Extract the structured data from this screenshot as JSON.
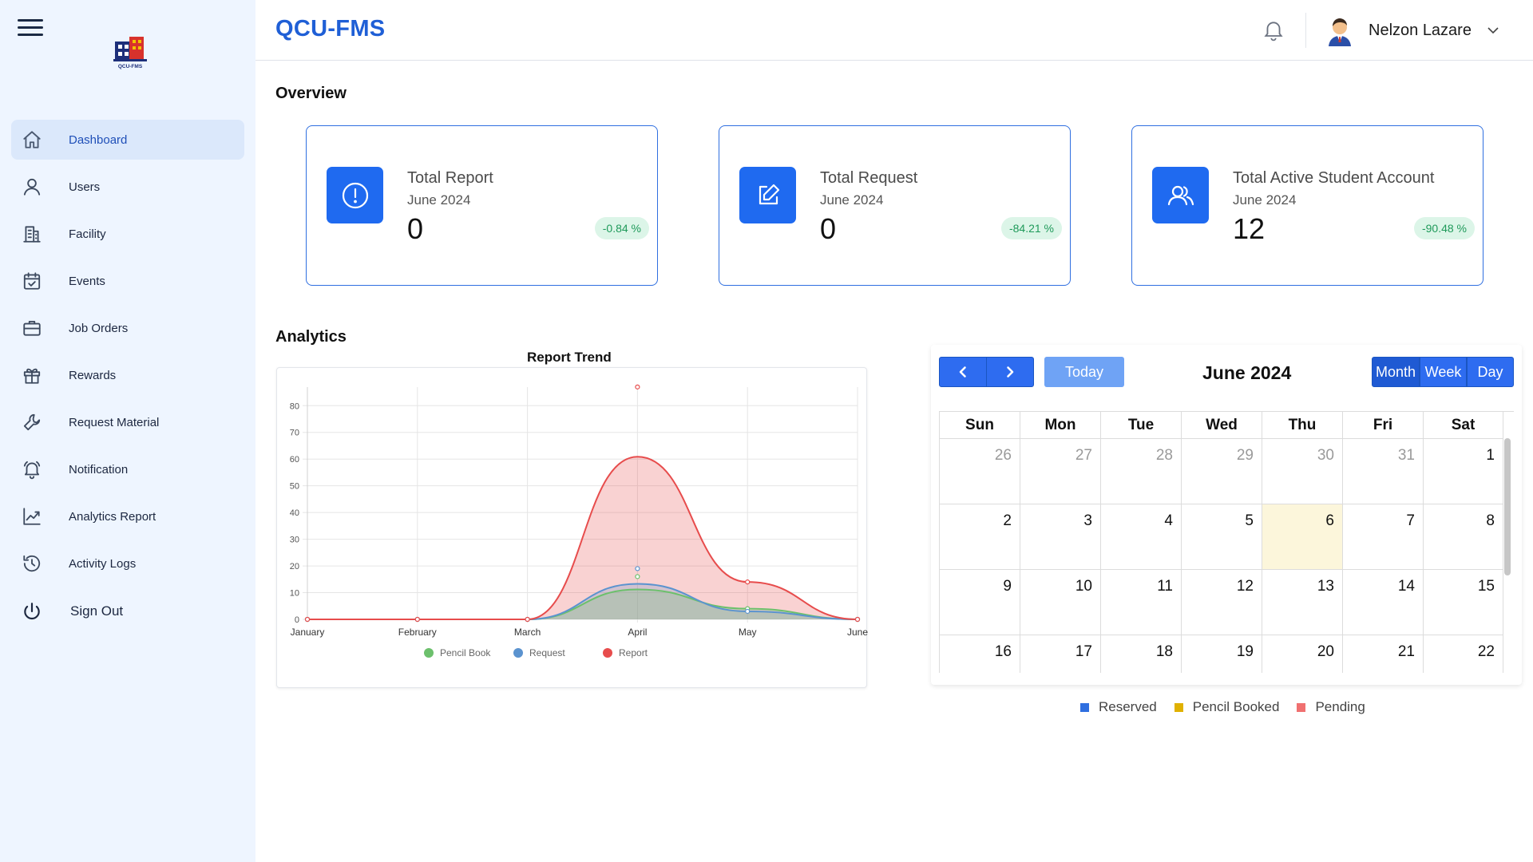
{
  "app": {
    "brand": "QCU-FMS",
    "logo_text": "QCU-FMS"
  },
  "sidebar": {
    "items": [
      {
        "label": "Dashboard",
        "icon": "home-icon",
        "active": true
      },
      {
        "label": "Users",
        "icon": "user-icon"
      },
      {
        "label": "Facility",
        "icon": "building-icon"
      },
      {
        "label": "Events",
        "icon": "calendar-check-icon"
      },
      {
        "label": "Job Orders",
        "icon": "briefcase-icon"
      },
      {
        "label": "Rewards",
        "icon": "gift-icon"
      },
      {
        "label": "Request Material",
        "icon": "wrench-icon"
      },
      {
        "label": "Notification",
        "icon": "bell-icon"
      },
      {
        "label": "Analytics Report",
        "icon": "trend-icon"
      },
      {
        "label": "Activity Logs",
        "icon": "history-icon"
      }
    ],
    "signout": {
      "label": "Sign Out",
      "icon": "power-icon"
    }
  },
  "header": {
    "user_name": "Nelzon Lazare"
  },
  "overview": {
    "title": "Overview",
    "cards": [
      {
        "title": "Total Report",
        "period": "June 2024",
        "value": "0",
        "change": "-0.84 %",
        "icon": "alert-circle-icon"
      },
      {
        "title": "Total Request",
        "period": "June 2024",
        "value": "0",
        "change": "-84.21 %",
        "icon": "edit-icon"
      },
      {
        "title": "Total Active Student Account",
        "period": "June 2024",
        "value": "12",
        "change": "-90.48 %",
        "icon": "users-icon"
      }
    ]
  },
  "analytics": {
    "title": "Analytics"
  },
  "chart_data": {
    "type": "area",
    "title": "Report Trend",
    "categories": [
      "January",
      "February",
      "March",
      "April",
      "May",
      "June"
    ],
    "ylim": [
      0,
      80
    ],
    "yticks": [
      0,
      10,
      20,
      30,
      40,
      50,
      60,
      70,
      80
    ],
    "grid": true,
    "legend_position": "bottom",
    "series": [
      {
        "name": "Pencil Book",
        "color": "#6cc06c",
        "values": [
          0,
          0,
          0,
          16,
          4,
          0
        ]
      },
      {
        "name": "Request",
        "color": "#5b93cf",
        "values": [
          0,
          0,
          0,
          19,
          3,
          0
        ]
      },
      {
        "name": "Report",
        "color": "#e74c4c",
        "values": [
          0,
          0,
          0,
          87,
          14,
          0
        ]
      }
    ]
  },
  "calendar": {
    "title": "June 2024",
    "today_label": "Today",
    "views": [
      "Month",
      "Week",
      "Day"
    ],
    "active_view": "Month",
    "weekdays": [
      "Sun",
      "Mon",
      "Tue",
      "Wed",
      "Thu",
      "Fri",
      "Sat"
    ],
    "weeks": [
      [
        {
          "d": "26",
          "m": true
        },
        {
          "d": "27",
          "m": true
        },
        {
          "d": "28",
          "m": true
        },
        {
          "d": "29",
          "m": true
        },
        {
          "d": "30",
          "m": true
        },
        {
          "d": "31",
          "m": true
        },
        {
          "d": "1"
        }
      ],
      [
        {
          "d": "2"
        },
        {
          "d": "3"
        },
        {
          "d": "4"
        },
        {
          "d": "5"
        },
        {
          "d": "6",
          "today": true
        },
        {
          "d": "7"
        },
        {
          "d": "8"
        }
      ],
      [
        {
          "d": "9"
        },
        {
          "d": "10"
        },
        {
          "d": "11"
        },
        {
          "d": "12"
        },
        {
          "d": "13"
        },
        {
          "d": "14"
        },
        {
          "d": "15"
        }
      ],
      [
        {
          "d": "16"
        },
        {
          "d": "17"
        },
        {
          "d": "18"
        },
        {
          "d": "19"
        },
        {
          "d": "20"
        },
        {
          "d": "21"
        },
        {
          "d": "22"
        }
      ]
    ],
    "legend": [
      {
        "label": "Reserved",
        "color": "#2f6fe0"
      },
      {
        "label": "Pencil Booked",
        "color": "#e0b100"
      },
      {
        "label": "Pending",
        "color": "#f07070"
      }
    ]
  }
}
